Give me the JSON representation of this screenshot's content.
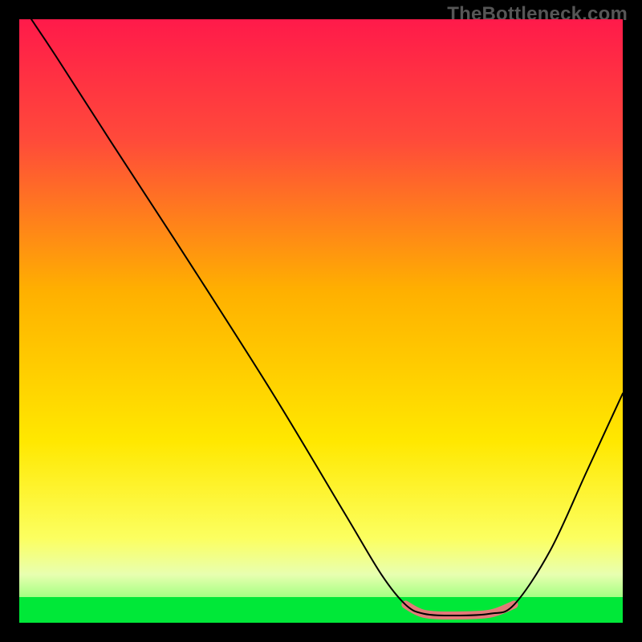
{
  "watermark": "TheBottleneck.com",
  "chart_data": {
    "type": "line",
    "title": "",
    "xlabel": "",
    "ylabel": "",
    "xlim": [
      0,
      100
    ],
    "ylim": [
      0,
      100
    ],
    "gradient": {
      "stops": [
        {
          "pct": 0,
          "color": "#ff1a4a"
        },
        {
          "pct": 20,
          "color": "#ff4a3a"
        },
        {
          "pct": 45,
          "color": "#ffb000"
        },
        {
          "pct": 70,
          "color": "#ffe800"
        },
        {
          "pct": 86,
          "color": "#fcff60"
        },
        {
          "pct": 92,
          "color": "#e8ffb0"
        },
        {
          "pct": 96,
          "color": "#a0ff80"
        },
        {
          "pct": 100,
          "color": "#00f040"
        }
      ],
      "bottom_band": {
        "from_pct": 95.8,
        "color": "#00e838"
      }
    },
    "series": [
      {
        "name": "bottleneck-curve",
        "stroke": "#000000",
        "points": [
          {
            "x": 2,
            "y": 100
          },
          {
            "x": 6,
            "y": 94
          },
          {
            "x": 15,
            "y": 80
          },
          {
            "x": 28,
            "y": 60
          },
          {
            "x": 42,
            "y": 38
          },
          {
            "x": 54,
            "y": 18
          },
          {
            "x": 60,
            "y": 8
          },
          {
            "x": 64,
            "y": 3
          },
          {
            "x": 67,
            "y": 1.5
          },
          {
            "x": 72,
            "y": 1.2
          },
          {
            "x": 78,
            "y": 1.5
          },
          {
            "x": 82,
            "y": 3
          },
          {
            "x": 88,
            "y": 12
          },
          {
            "x": 94,
            "y": 25
          },
          {
            "x": 100,
            "y": 38
          }
        ]
      }
    ],
    "highlight": {
      "name": "optimum-band",
      "color": "#e27a78",
      "points": [
        {
          "x": 64,
          "y": 3
        },
        {
          "x": 67,
          "y": 1.5
        },
        {
          "x": 72,
          "y": 1.2
        },
        {
          "x": 78,
          "y": 1.5
        },
        {
          "x": 82,
          "y": 3
        }
      ]
    }
  }
}
